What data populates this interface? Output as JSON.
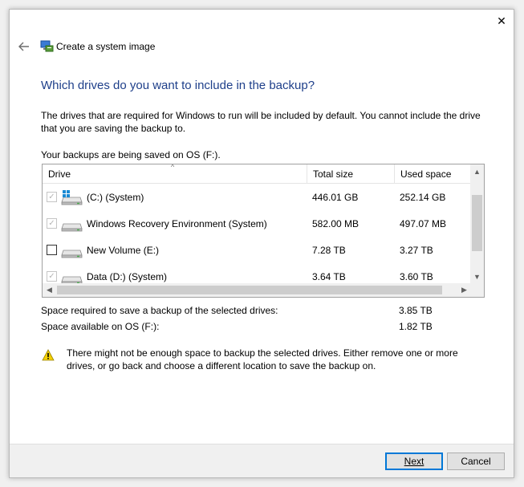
{
  "window": {
    "title": "Create a system image",
    "close_glyph": "✕",
    "back_glyph": "←"
  },
  "heading": "Which drives do you want to include in the backup?",
  "description": "The drives that are required for Windows to run will be included by default. You cannot include the drive that you are saving the backup to.",
  "saving_on": "Your backups are being saved on OS (F:).",
  "table": {
    "columns": [
      "Drive",
      "Total size",
      "Used space"
    ],
    "rows": [
      {
        "name": "(C:) (System)",
        "total": "446.01 GB",
        "used": "252.14 GB",
        "checked": true,
        "disabled": true,
        "icon": "windows-drive-icon"
      },
      {
        "name": "Windows Recovery Environment (System)",
        "total": "582.00 MB",
        "used": "497.07 MB",
        "checked": true,
        "disabled": true,
        "icon": "hard-drive-icon"
      },
      {
        "name": "New Volume (E:)",
        "total": "7.28 TB",
        "used": "3.27 TB",
        "checked": false,
        "disabled": false,
        "icon": "hard-drive-icon"
      },
      {
        "name": "Data (D:) (System)",
        "total": "3.64 TB",
        "used": "3.60 TB",
        "checked": true,
        "disabled": true,
        "icon": "hard-drive-icon"
      }
    ]
  },
  "space": {
    "required_label": "Space required to save a backup of the selected drives:",
    "required_value": "3.85 TB",
    "available_label": "Space available on OS (F:):",
    "available_value": "1.82 TB"
  },
  "warning": "There might not be enough space to backup the selected drives. Either remove one or more drives, or go back and choose a different location to save the backup on.",
  "buttons": {
    "next": "Next",
    "cancel": "Cancel"
  },
  "colors": {
    "heading": "#1e3f8a",
    "default_button_border": "#0078d7",
    "warning_yellow": "#f4d000"
  }
}
